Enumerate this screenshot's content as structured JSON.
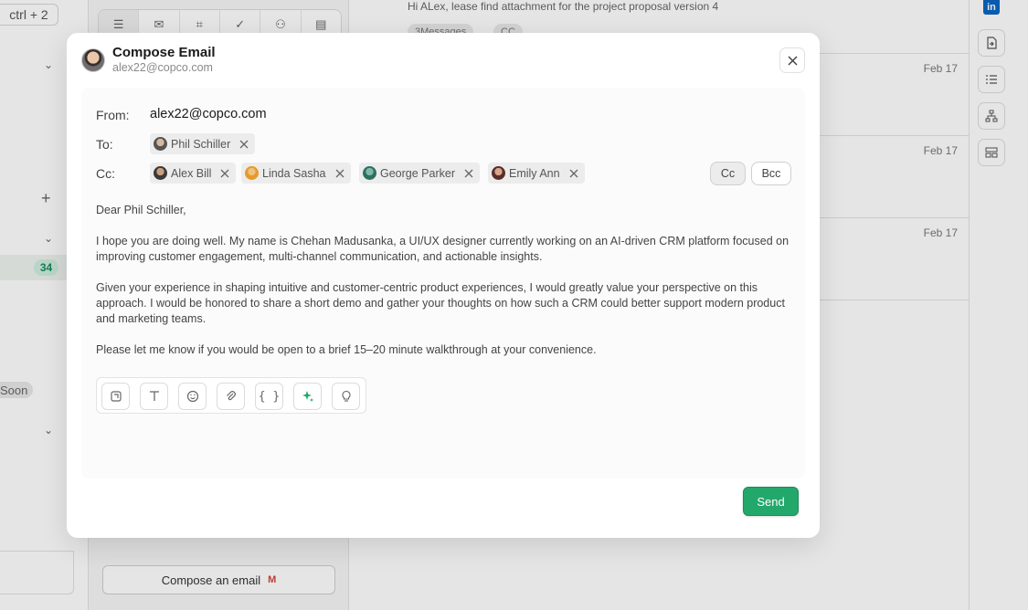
{
  "background": {
    "shortcut_hint": "ctrl + 2",
    "unread_count": "34",
    "soon_badge": "Soon",
    "compose_button": "Compose an email",
    "preview_text": "Hi ALex, lease find attachment for the project proposal version 4",
    "preview_chips": [
      "3Messages",
      "CC"
    ],
    "row_dates": [
      "Feb 17",
      "Feb 17",
      "Feb 17"
    ],
    "linkedin_label": "in"
  },
  "modal": {
    "title": "Compose Email",
    "sender_email": "alex22@copco.com",
    "from_label": "From:",
    "from_value": "alex22@copco.com",
    "to_label": "To:",
    "cc_label": "Cc:",
    "to_recipients": [
      {
        "name": "Phil Schiller"
      }
    ],
    "cc_recipients": [
      {
        "name": "Alex Bill"
      },
      {
        "name": "Linda Sasha"
      },
      {
        "name": "George Parker"
      },
      {
        "name": "Emily Ann"
      }
    ],
    "cc_button": "Cc",
    "bcc_button": "Bcc",
    "body_paragraphs": [
      "Dear Phil Schiller,",
      "I hope you are doing well. My name is Chehan Madusanka, a UI/UX designer currently working on an AI-driven CRM platform focused on improving customer engagement, multi-channel communication, and actionable insights.",
      "Given your experience in shaping intuitive and customer-centric product experiences, I would greatly value your perspective on this approach. I would be honored to share a short demo and gather your thoughts on how such a CRM could better support modern product and marketing teams.",
      "Please let me know if you would be open to a brief 15–20 minute walkthrough at your convenience."
    ],
    "send_button": "Send"
  },
  "colors": {
    "send_green": "#23a86b",
    "badge_green": "#1a8a5a",
    "linkedin_blue": "#0a66c2"
  }
}
